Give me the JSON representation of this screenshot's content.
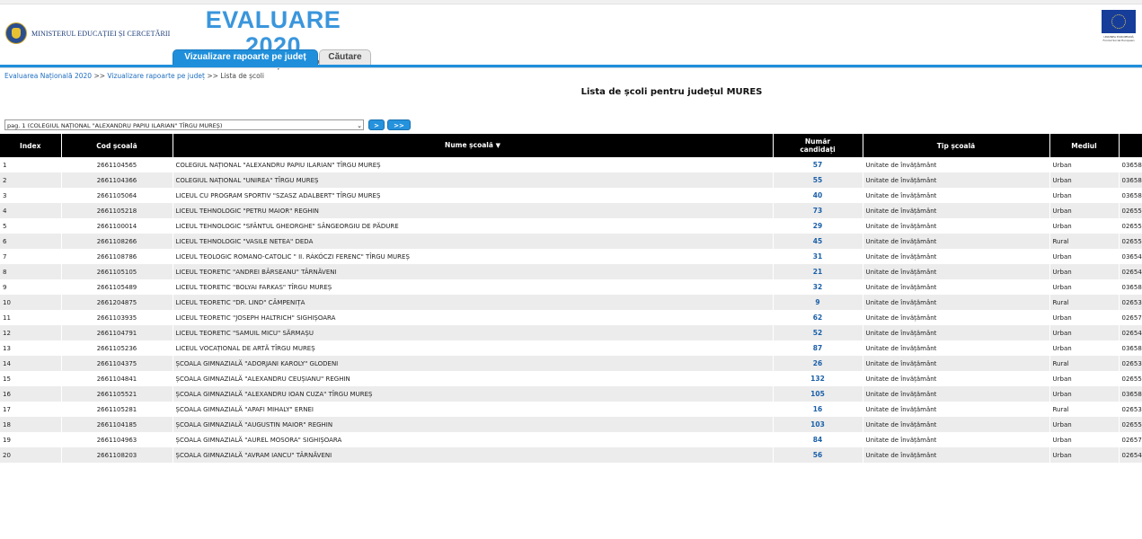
{
  "header": {
    "ministry": "MINISTERUL EDUCAȚIEI ȘI CERCETĂRII",
    "title": "EVALUARE 2020",
    "subtitle": "Evaluarea Națională 2020",
    "eu_caption": "UNIUNEA EUROPEANĂ Fondul Social European"
  },
  "tabs": [
    {
      "label": "Vizualizare rapoarte pe județ",
      "active": true
    },
    {
      "label": "Căutare",
      "active": false
    }
  ],
  "breadcrumb": {
    "items": [
      "Evaluarea Națională 2020",
      "Vizualizare rapoarte pe județ",
      "Lista de școli"
    ],
    "separator": ">>"
  },
  "page_title": "Lista de școli pentru județul MURES",
  "pager": {
    "selected": "pag. 1 (COLEGIUL NAȚIONAL \"ALEXANDRU PAPIU ILARIAN\" TÎRGU MUREȘ)",
    "next_label": ">",
    "last_label": ">>"
  },
  "table": {
    "headers": {
      "index": "Index",
      "code": "Cod școală",
      "name": "Nume școală",
      "sort_icon": "▼",
      "candidates": "Număr candidați",
      "type": "Tip școală",
      "mediu": "Mediul",
      "phone": ""
    },
    "rows": [
      {
        "index": "1",
        "code": "2661104565",
        "name": "COLEGIUL NAȚIONAL \"ALEXANDRU PAPIU ILARIAN\" TÎRGU MUREȘ",
        "count": "57",
        "type": "Unitate de învățământ",
        "mediu": "Urban",
        "phone": "03658"
      },
      {
        "index": "2",
        "code": "2661104366",
        "name": "COLEGIUL NAȚIONAL \"UNIREA\" TÎRGU MUREȘ",
        "count": "55",
        "type": "Unitate de învățământ",
        "mediu": "Urban",
        "phone": "03658"
      },
      {
        "index": "3",
        "code": "2661105064",
        "name": "LICEUL CU PROGRAM SPORTIV \"SZASZ ADALBERT\" TÎRGU MUREȘ",
        "count": "40",
        "type": "Unitate de învățământ",
        "mediu": "Urban",
        "phone": "03658"
      },
      {
        "index": "4",
        "code": "2661105218",
        "name": "LICEUL TEHNOLOGIC \"PETRU MAIOR\" REGHIN",
        "count": "73",
        "type": "Unitate de învățământ",
        "mediu": "Urban",
        "phone": "02655"
      },
      {
        "index": "5",
        "code": "2661100014",
        "name": "LICEUL TEHNOLOGIC \"SFÂNTUL GHEORGHE\" SÂNGEORGIU DE PĂDURE",
        "count": "29",
        "type": "Unitate de învățământ",
        "mediu": "Urban",
        "phone": "02655"
      },
      {
        "index": "6",
        "code": "2661108266",
        "name": "LICEUL TEHNOLOGIC \"VASILE NETEA\" DEDA",
        "count": "45",
        "type": "Unitate de învățământ",
        "mediu": "Rural",
        "phone": "02655"
      },
      {
        "index": "7",
        "code": "2661108786",
        "name": "LICEUL TEOLOGIC ROMANO-CATOLIC \" II. RÁKÓCZI FERENC\" TÎRGU MUREȘ",
        "count": "31",
        "type": "Unitate de învățământ",
        "mediu": "Urban",
        "phone": "03654"
      },
      {
        "index": "8",
        "code": "2661105105",
        "name": "LICEUL TEORETIC \"ANDREI BÂRSEANU\" TÂRNĂVENI",
        "count": "21",
        "type": "Unitate de învățământ",
        "mediu": "Urban",
        "phone": "02654"
      },
      {
        "index": "9",
        "code": "2661105489",
        "name": "LICEUL TEORETIC \"BOLYAI FARKAS\" TÎRGU MUREȘ",
        "count": "32",
        "type": "Unitate de învățământ",
        "mediu": "Urban",
        "phone": "03658"
      },
      {
        "index": "10",
        "code": "2661204875",
        "name": "LICEUL TEORETIC \"DR. LIND\" CÂMPENIȚA",
        "count": "9",
        "type": "Unitate de învățământ",
        "mediu": "Rural",
        "phone": "02653"
      },
      {
        "index": "11",
        "code": "2661103935",
        "name": "LICEUL TEORETIC \"JOSEPH HALTRICH\" SIGHIȘOARA",
        "count": "62",
        "type": "Unitate de învățământ",
        "mediu": "Urban",
        "phone": "02657"
      },
      {
        "index": "12",
        "code": "2661104791",
        "name": "LICEUL TEORETIC \"SAMUIL MICU\" SĂRMAȘU",
        "count": "52",
        "type": "Unitate de învățământ",
        "mediu": "Urban",
        "phone": "02654"
      },
      {
        "index": "13",
        "code": "2661105236",
        "name": "LICEUL VOCAȚIONAL DE ARTĂ TÎRGU MUREȘ",
        "count": "87",
        "type": "Unitate de învățământ",
        "mediu": "Urban",
        "phone": "03658"
      },
      {
        "index": "14",
        "code": "2661104375",
        "name": "ȘCOALA GIMNAZIALĂ \"ADORJANI KAROLY\" GLODENI",
        "count": "26",
        "type": "Unitate de învățământ",
        "mediu": "Rural",
        "phone": "02653"
      },
      {
        "index": "15",
        "code": "2661104841",
        "name": "ȘCOALA GIMNAZIALĂ \"ALEXANDRU CEUȘIANU\" REGHIN",
        "count": "132",
        "type": "Unitate de învățământ",
        "mediu": "Urban",
        "phone": "02655"
      },
      {
        "index": "16",
        "code": "2661105521",
        "name": "ȘCOALA GIMNAZIALĂ \"ALEXANDRU IOAN CUZA\" TÎRGU MUREȘ",
        "count": "105",
        "type": "Unitate de învățământ",
        "mediu": "Urban",
        "phone": "03658"
      },
      {
        "index": "17",
        "code": "2661105281",
        "name": "ȘCOALA GIMNAZIALĂ \"APAFI MIHALY\" ERNEI",
        "count": "16",
        "type": "Unitate de învățământ",
        "mediu": "Rural",
        "phone": "02653"
      },
      {
        "index": "18",
        "code": "2661104185",
        "name": "ȘCOALA GIMNAZIALĂ \"AUGUSTIN MAIOR\" REGHIN",
        "count": "103",
        "type": "Unitate de învățământ",
        "mediu": "Urban",
        "phone": "02655"
      },
      {
        "index": "19",
        "code": "2661104963",
        "name": "ȘCOALA GIMNAZIALĂ \"AUREL MOSORA\" SIGHIȘOARA",
        "count": "84",
        "type": "Unitate de învățământ",
        "mediu": "Urban",
        "phone": "02657"
      },
      {
        "index": "20",
        "code": "2661108203",
        "name": "ȘCOALA GIMNAZIALĂ \"AVRAM IANCU\" TÂRNĂVENI",
        "count": "56",
        "type": "Unitate de învățământ",
        "mediu": "Urban",
        "phone": "02654"
      }
    ]
  }
}
